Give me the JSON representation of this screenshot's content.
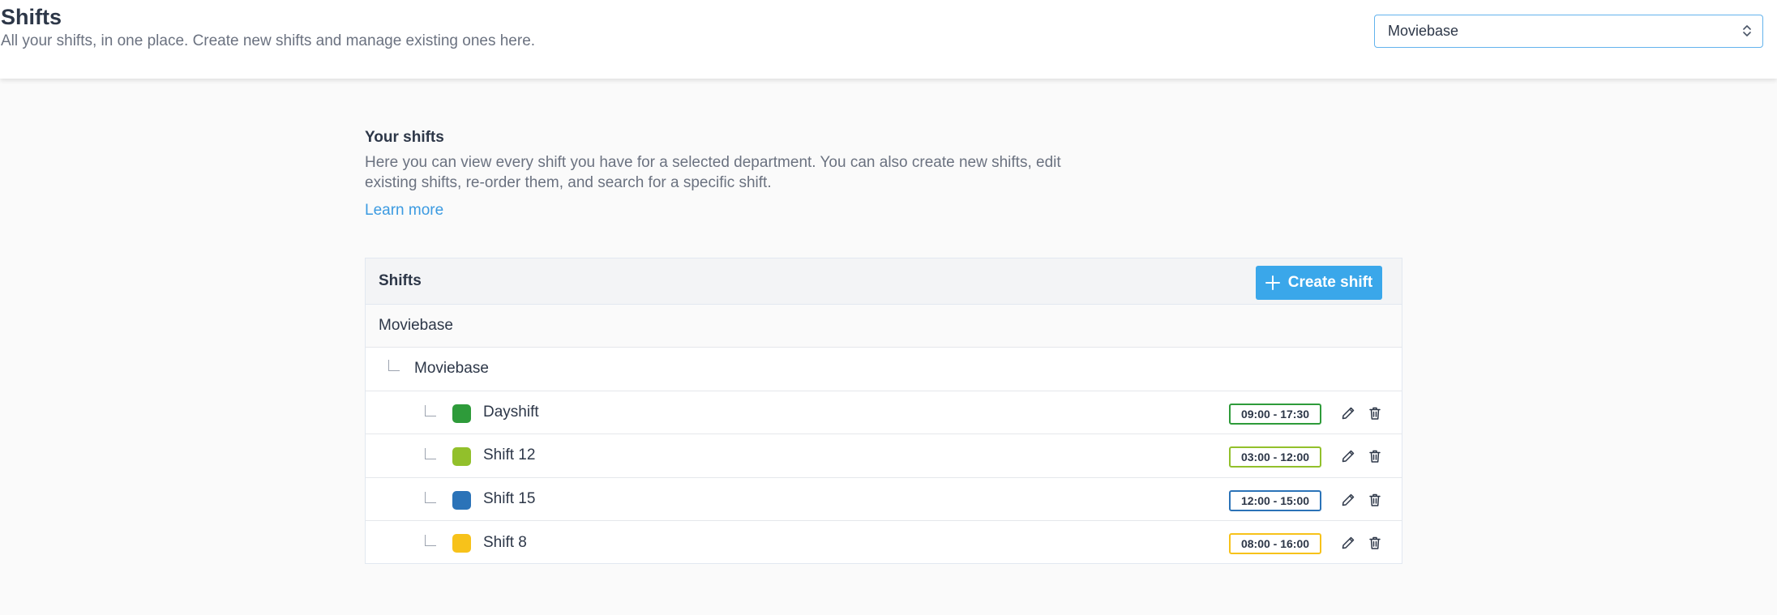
{
  "header": {
    "title": "Shifts",
    "subtitle": "All your shifts, in one place. Create new shifts and manage existing ones here.",
    "department_select": "Moviebase"
  },
  "intro": {
    "heading": "Your shifts",
    "text": "Here you can view every shift you have for a selected department. You can also create new shifts, edit existing shifts, re-order them, and search for a specific shift.",
    "learn_more": "Learn more"
  },
  "panel": {
    "title": "Shifts",
    "create_label": "Create shift",
    "department": "Moviebase",
    "subdepartment": "Moviebase",
    "shifts": [
      {
        "name": "Dayshift",
        "time": "09:00 - 17:30",
        "color": "#2e9b3a"
      },
      {
        "name": "Shift 12",
        "time": "03:00 - 12:00",
        "color": "#92c02b"
      },
      {
        "name": "Shift 15",
        "time": "12:00 - 15:00",
        "color": "#2b73b8"
      },
      {
        "name": "Shift 8",
        "time": "08:00 - 16:00",
        "color": "#f7c21a"
      }
    ]
  },
  "colors": {
    "accent": "#3aa7ea",
    "link": "#3b9ae1"
  }
}
